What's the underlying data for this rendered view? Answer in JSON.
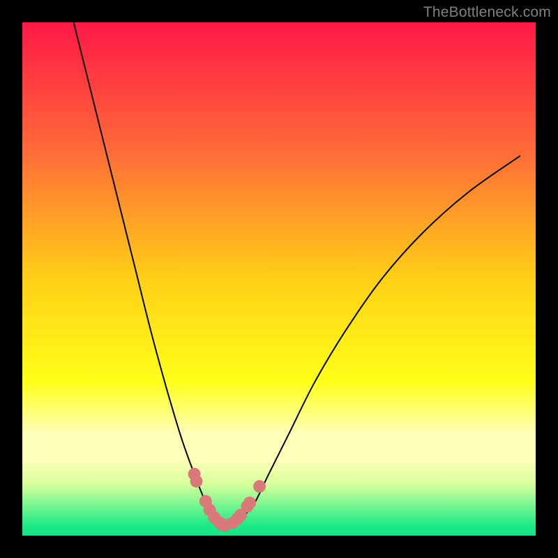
{
  "watermark": "TheBottleneck.com",
  "chart_data": {
    "type": "line",
    "title": "",
    "xlabel": "",
    "ylabel": "",
    "xlim": [
      0,
      100
    ],
    "ylim": [
      0,
      100
    ],
    "grid": false,
    "series": [
      {
        "name": "bottleneck-curve",
        "x": [
          10,
          13,
          16,
          19,
          22,
          25,
          28,
          31,
          33.5,
          35.5,
          37,
          38.5,
          40,
          42,
          45,
          48,
          52,
          57,
          63,
          70,
          78,
          87,
          97
        ],
        "y": [
          100,
          88,
          76,
          64,
          52,
          40,
          29,
          19,
          12,
          7,
          4,
          2.5,
          2,
          3,
          6,
          12,
          20,
          30,
          40,
          50,
          59,
          67,
          74
        ]
      },
      {
        "name": "markers-left",
        "x": [
          33.5,
          33.9,
          35.7,
          36.5,
          37.4,
          38.4,
          38.9,
          39.5
        ],
        "y": [
          12,
          10.6,
          6.7,
          5.0,
          3.5,
          2.5,
          2.1,
          2.0
        ]
      },
      {
        "name": "markers-right",
        "x": [
          41.0,
          41.9,
          42.5,
          43.8,
          44.3,
          46.2
        ],
        "y": [
          2.5,
          3.3,
          4.0,
          5.7,
          6.4,
          9.6
        ]
      }
    ],
    "background_gradient": {
      "stops": [
        {
          "pos": 0.0,
          "color": "#ff1846"
        },
        {
          "pos": 0.25,
          "color": "#ff6a38"
        },
        {
          "pos": 0.5,
          "color": "#ffd016"
        },
        {
          "pos": 0.7,
          "color": "#ffff19"
        },
        {
          "pos": 0.8,
          "color": "#ffffb8"
        },
        {
          "pos": 0.85,
          "color": "#ffffba"
        },
        {
          "pos": 0.9,
          "color": "#d7ff9a"
        },
        {
          "pos": 0.94,
          "color": "#7af58f"
        },
        {
          "pos": 0.98,
          "color": "#1fe886"
        },
        {
          "pos": 1.0,
          "color": "#13e584"
        }
      ]
    },
    "marker_color": "#d87a7a",
    "marker_radius": 9,
    "curve_color": "#000000",
    "curve_width": 2
  }
}
